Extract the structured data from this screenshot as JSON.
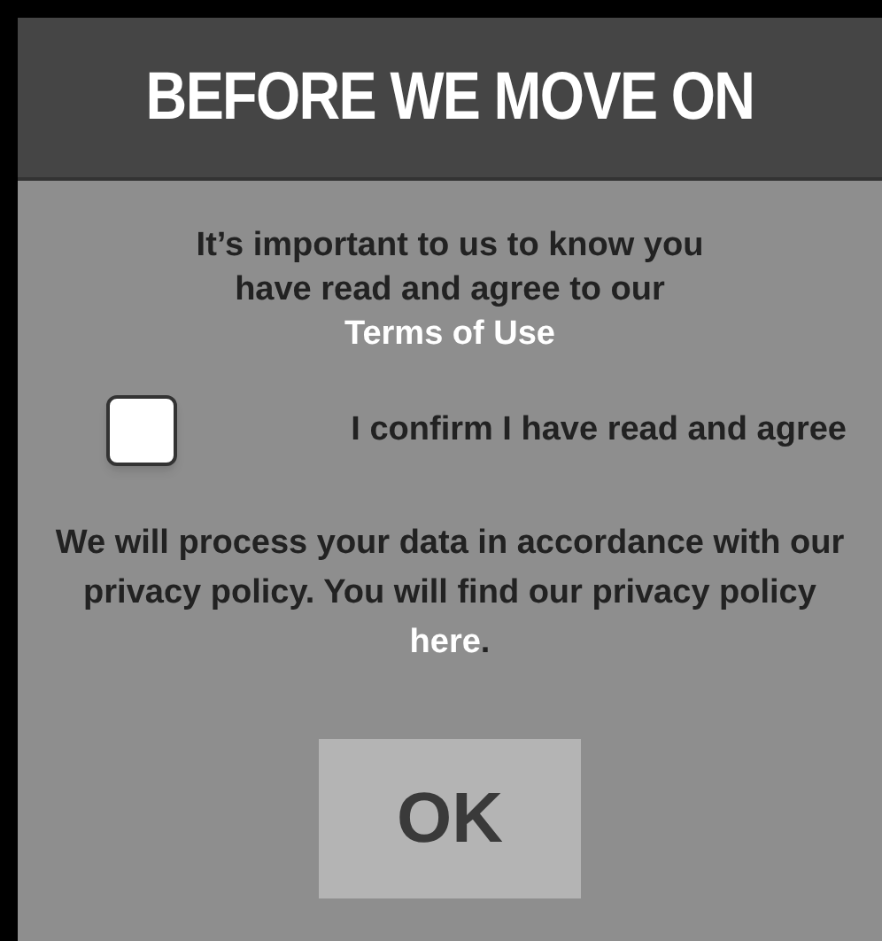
{
  "header": {
    "title": "BEFORE WE MOVE ON"
  },
  "intro": {
    "text": "It’s important to us to know you have read and agree to our ",
    "link": "Terms of Use"
  },
  "confirm": {
    "label": "I confirm I have read and agree",
    "checked": false
  },
  "privacy": {
    "text": "We will process your data in accordance with our privacy policy. You will find our privacy policy ",
    "link": "here",
    "after": "."
  },
  "ok_button": {
    "label": "OK"
  }
}
